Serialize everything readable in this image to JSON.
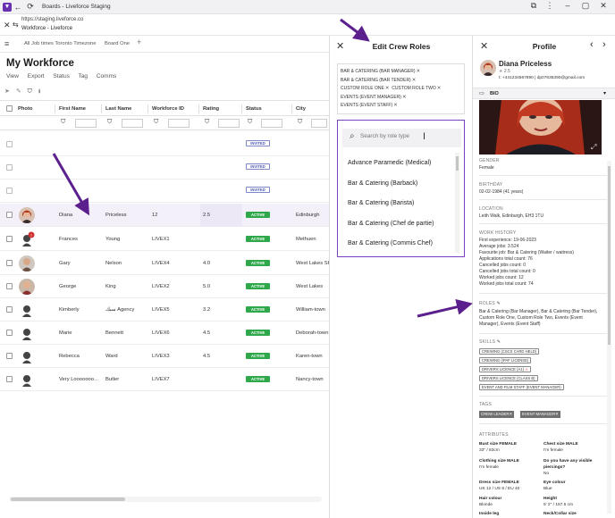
{
  "window": {
    "title": "Boards - Liveforce Staging",
    "url": "https://staging.liveforce.co",
    "page_name": "Workforce - Liveforce"
  },
  "tabs": [
    "All Job times Toronto Timezone",
    "Board One"
  ],
  "workforce": {
    "title": "My Workforce",
    "actions": [
      "View",
      "Export",
      "Status",
      "Tag",
      "Comms"
    ],
    "columns": [
      "Photo",
      "First Name",
      "Last Name",
      "Workforce ID",
      "Rating",
      "Status",
      "City"
    ],
    "rows": [
      {
        "first": "",
        "last": "",
        "id": "",
        "rating": "",
        "status": "INVITED",
        "city": ""
      },
      {
        "first": "",
        "last": "",
        "id": "",
        "rating": "",
        "status": "INVITED",
        "city": ""
      },
      {
        "first": "",
        "last": "",
        "id": "",
        "rating": "",
        "status": "INVITED",
        "city": ""
      },
      {
        "first": "Diana",
        "last": "Priceless",
        "id": "12",
        "rating": "2.5",
        "status": "ACTIVE",
        "city": "Edinburgh"
      },
      {
        "first": "Frances",
        "last": "Young",
        "id": "LIVEX1",
        "rating": "",
        "status": "ACTIVE",
        "city": "Methuen"
      },
      {
        "first": "Gary",
        "last": "Nelson",
        "id": "LIVEX4",
        "rating": "4.0",
        "status": "ACTIVE",
        "city": "West Lakes Shore"
      },
      {
        "first": "George",
        "last": "King",
        "id": "LIVEX2",
        "rating": "5.0",
        "status": "ACTIVE",
        "city": "West Lakes"
      },
      {
        "first": "Kimberly",
        "last": "سبك Agency",
        "id": "LIVEX5",
        "rating": "3.2",
        "status": "ACTIVE",
        "city": "William-town"
      },
      {
        "first": "Marie",
        "last": "Bennett",
        "id": "LIVEX6",
        "rating": "4.5",
        "status": "ACTIVE",
        "city": "Deborah-town"
      },
      {
        "first": "Rebecca",
        "last": "Ward",
        "id": "LIVEX3",
        "rating": "4.5",
        "status": "ACTIVE",
        "city": "Karen-town"
      },
      {
        "first": "Very Looooooo...",
        "last": "Butler",
        "id": "LIVEX7",
        "rating": "",
        "status": "ACTIVE",
        "city": "Nancy-town"
      }
    ]
  },
  "modal": {
    "title": "Edit Crew Roles",
    "selected_roles": [
      "BAR & CATERING (BAR MANAGER)",
      "BAR & CATERING (BAR TENDER)",
      "CUSTOM ROLE ONE",
      "CUSTOM ROLE TWO",
      "EVENTS (EVENT MANAGER)",
      "EVENTS (EVENT STAFF)"
    ],
    "search_placeholder": "Search by role type",
    "options": [
      "Advance Paramedic (Medical)",
      "Bar & Catering (Barback)",
      "Bar & Catering (Barista)",
      "Bar & Catering (Chef de partie)",
      "Bar & Catering (Commis Chef)"
    ]
  },
  "profile": {
    "title": "Profile",
    "name": "Diana Priceless",
    "rating": "2.5",
    "contact": "t: +441234567890 | dp07635390@gmail.com",
    "bio_label": "BIO",
    "gender_label": "GENDER",
    "gender": "Female",
    "birthday_label": "BIRTHDAY",
    "birthday": "02-02-1984 (41 years)",
    "location_label": "LOCATION",
    "location": "Leith Walk, Edinburgh, EH3 1TU",
    "work_history_label": "WORK HISTORY",
    "work_history": [
      "First experience: 19-06-2023",
      "Average jobs: 3.524",
      "Favourite job: Bar & Catering (Waiter / waitress)",
      "Applications total count: 76",
      "Cancelled jobs count: 0",
      "Cancelled jobs total count: 0",
      "Worked jobs count: 12",
      "Worked jobs total count: 74"
    ],
    "roles_label": "ROLES",
    "roles_lines": [
      "Bar & Catering (Bar Manager), Bar & Catering (Bar Tender),",
      "Custom Role One, Custom Role Two, Events (Event",
      "Manager), Events (Event Staff)"
    ],
    "skills_label": "SKILLS",
    "skills": [
      "CREWING (CSCS CARD HELD)",
      "CREWING (IPAF LICENSE)",
      "DRIVERS LICENCE (A1)",
      "DRIVERS LICENCE (CLASS B)",
      "EVENT AND FILM STAFF (EVENT MANAGER)"
    ],
    "tags_label": "TAGS",
    "tags": [
      "CREW LEADER",
      "EVENT MANAGER"
    ],
    "attributes_label": "ATTRIBUTES",
    "attributes": [
      {
        "label": "Bust size FEMALE",
        "value": "33\" / 83cm"
      },
      {
        "label": "Chest size MALE",
        "value": "I'm female"
      },
      {
        "label": "Clothing size MALE",
        "value": "I'm female"
      },
      {
        "label": "Do you have any visible piercings?",
        "value": "No"
      },
      {
        "label": "Dress size FEMALE",
        "value": "UK 12 / US 8 / EU 40"
      },
      {
        "label": "Eye colour",
        "value": "Blue"
      },
      {
        "label": "Hair colour",
        "value": "Blonde"
      },
      {
        "label": "Height",
        "value": "5' 2\" / 157.5 cm"
      },
      {
        "label": "Inside leg",
        "value": ""
      },
      {
        "label": "Neck/Collar size",
        "value": ""
      }
    ]
  },
  "colors": {
    "accent": "#6a2fb0",
    "active": "#2ea84a",
    "invited": "#4a5ab0",
    "arrow": "#5b1f8e"
  }
}
